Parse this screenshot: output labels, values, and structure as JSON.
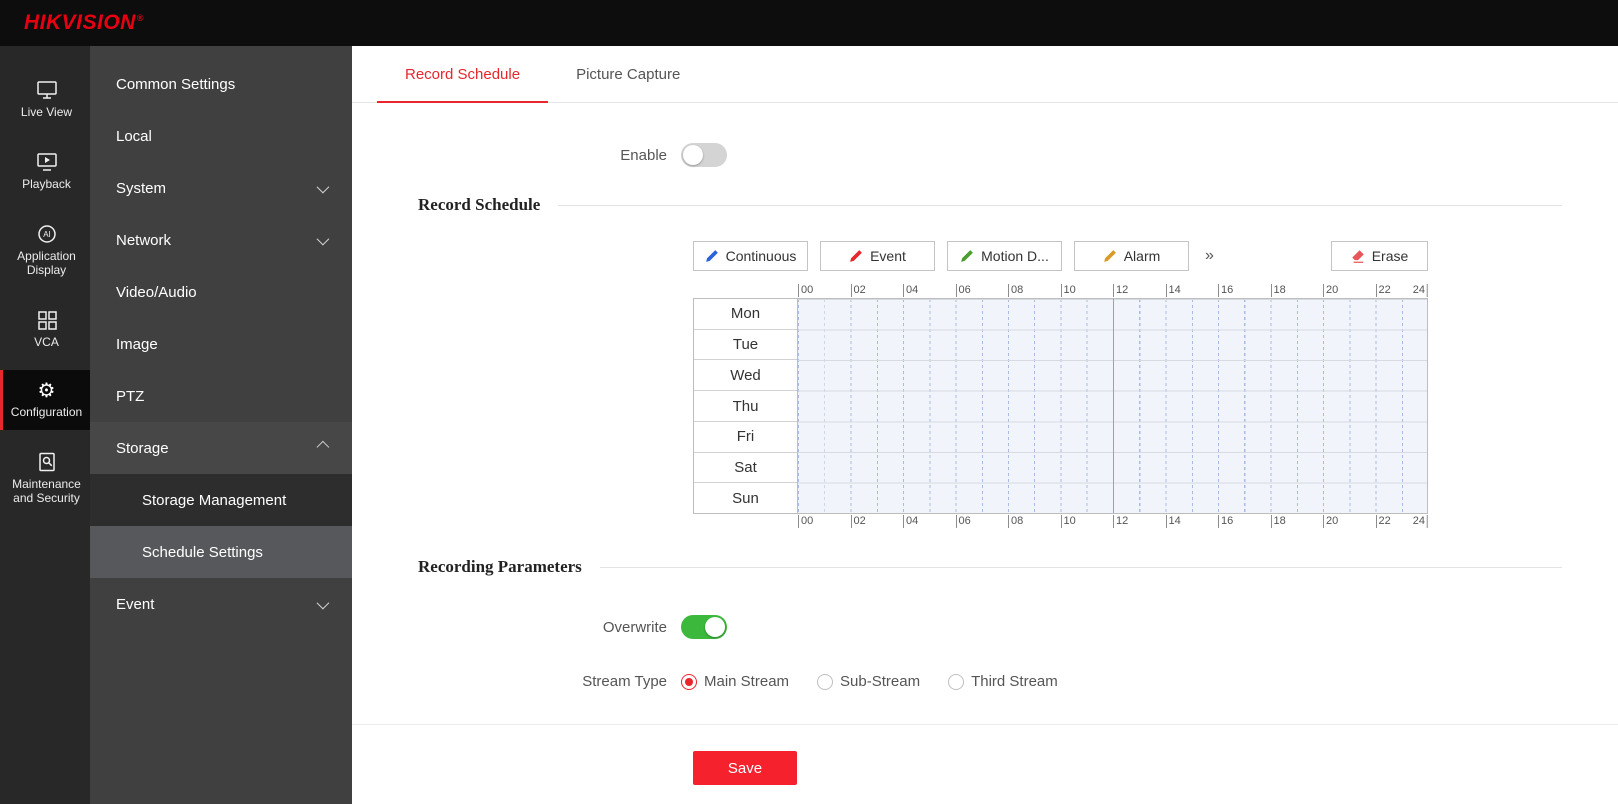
{
  "brand": {
    "logo": "HIKVISION",
    "registered": "®"
  },
  "colors": {
    "logo_red": "#e60012",
    "accent": "#e7262d",
    "toggle_on": "#3cb93c",
    "save_button": "#f5222d"
  },
  "nav": {
    "items": [
      {
        "label": "Live View"
      },
      {
        "label": "Playback"
      },
      {
        "label": "Application Display"
      },
      {
        "label": "VCA"
      },
      {
        "label": "Configuration",
        "active": true
      },
      {
        "label": "Maintenance and Security"
      }
    ]
  },
  "menu": {
    "items": [
      {
        "label": "Common Settings"
      },
      {
        "label": "Local"
      },
      {
        "label": "System",
        "chevron": "down"
      },
      {
        "label": "Network",
        "chevron": "down"
      },
      {
        "label": "Video/Audio"
      },
      {
        "label": "Image"
      },
      {
        "label": "PTZ"
      },
      {
        "label": "Storage",
        "chevron": "up",
        "expanded": true
      },
      {
        "label": "Storage Management",
        "sub": true
      },
      {
        "label": "Schedule Settings",
        "sub": true,
        "selected": true
      },
      {
        "label": "Event",
        "chevron": "down"
      }
    ]
  },
  "tabs": [
    {
      "label": "Record Schedule",
      "active": true
    },
    {
      "label": "Picture Capture",
      "active": false
    }
  ],
  "enable": {
    "label": "Enable",
    "state": "off"
  },
  "schedule": {
    "heading": "Record Schedule",
    "tools": [
      {
        "label": "Continuous",
        "color": "#2a62d9"
      },
      {
        "label": "Event",
        "color": "#e7262d"
      },
      {
        "label": "Motion D...",
        "color": "#4a9e2f"
      },
      {
        "label": "Alarm",
        "color": "#d99b26"
      }
    ],
    "more": "»",
    "erase": {
      "label": "Erase",
      "color": "#e7565a"
    },
    "hour_labels": [
      "00",
      "02",
      "04",
      "06",
      "08",
      "10",
      "12",
      "14",
      "16",
      "18",
      "20",
      "22",
      "24"
    ],
    "days": [
      "Mon",
      "Tue",
      "Wed",
      "Thu",
      "Fri",
      "Sat",
      "Sun"
    ]
  },
  "params": {
    "heading": "Recording Parameters",
    "overwrite_label": "Overwrite",
    "overwrite_state": "on",
    "stream_type_label": "Stream Type",
    "stream_options": [
      {
        "label": "Main Stream",
        "selected": true
      },
      {
        "label": "Sub-Stream",
        "selected": false
      },
      {
        "label": "Third Stream",
        "selected": false
      }
    ]
  },
  "save_label": "Save"
}
